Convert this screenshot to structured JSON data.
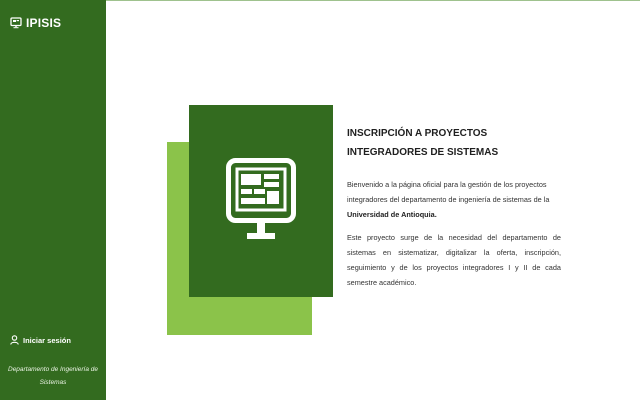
{
  "sidebar": {
    "brand": "IPISIS",
    "brand_icon": "monitor-icon",
    "login_label": "Iniciar sesión",
    "login_icon": "user-icon",
    "department": "Departamento de Ingeniería de Sistemas"
  },
  "main": {
    "hero_icon": "monitor-icon",
    "title": "INSCRIPCIÓN A PROYECTOS INTEGRADORES DE SISTEMAS",
    "intro_text": "Bienvenido a la página oficial para la gestión de los proyectos integradores del departamento de ingeniería de sistemas de la",
    "university": "Universidad de Antioquia.",
    "description": "Este proyecto surge de la necesidad del departamento de sistemas en sistematizar, digitalizar la oferta, inscripción, seguimiento y de los proyectos integradores I y II de cada semestre académico."
  },
  "colors": {
    "sidebar_bg": "#336b1f",
    "dark_green": "#336b1f",
    "light_green": "#8bc34a"
  }
}
